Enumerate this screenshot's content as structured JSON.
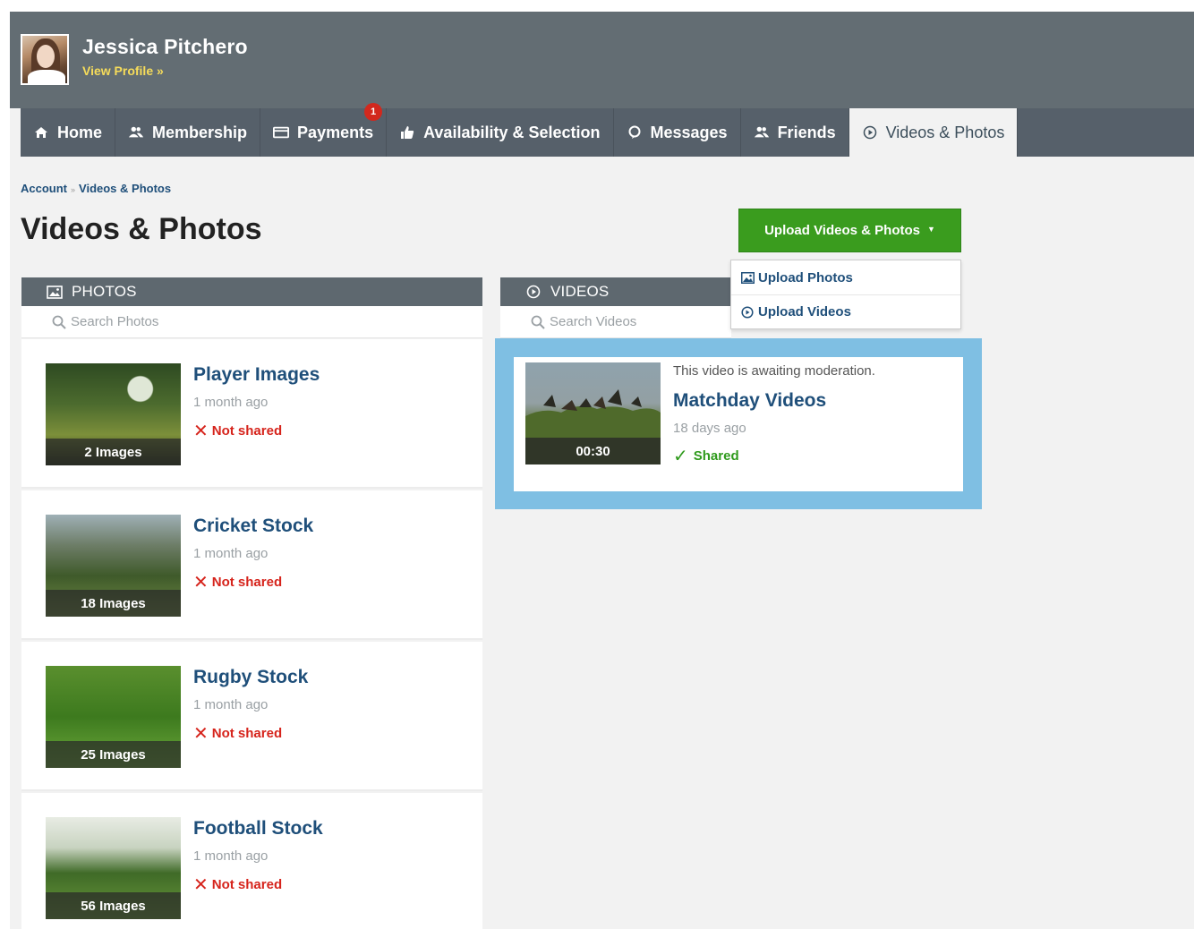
{
  "header": {
    "user_name": "Jessica Pitchero",
    "view_profile": "View Profile »"
  },
  "nav": {
    "items": [
      {
        "label": "Home",
        "icon": "home-icon"
      },
      {
        "label": "Membership",
        "icon": "users-icon"
      },
      {
        "label": "Payments",
        "icon": "credit-card-icon",
        "badge": "1"
      },
      {
        "label": "Availability & Selection",
        "icon": "thumbs-up-icon"
      },
      {
        "label": "Messages",
        "icon": "chat-bubble-icon"
      },
      {
        "label": "Friends",
        "icon": "users-icon"
      },
      {
        "label": "Videos & Photos",
        "icon": "play-circle-icon",
        "active": true
      }
    ]
  },
  "breadcrumb": {
    "items": [
      "Account",
      "Videos & Photos"
    ],
    "separator": "»"
  },
  "page": {
    "title": "Videos & Photos"
  },
  "upload": {
    "button_label": "Upload Videos & Photos",
    "caret": "▼",
    "menu": [
      {
        "label": "Upload Photos",
        "icon": "image-icon"
      },
      {
        "label": "Upload Videos",
        "icon": "play-circle-icon"
      }
    ]
  },
  "photos": {
    "heading": "PHOTOS",
    "search_placeholder": "Search Photos",
    "albums": [
      {
        "title": "Player Images",
        "date": "1 month ago",
        "count": "2 Images",
        "status": "Not shared"
      },
      {
        "title": "Cricket Stock",
        "date": "1 month ago",
        "count": "18 Images",
        "status": "Not shared"
      },
      {
        "title": "Rugby Stock",
        "date": "1 month ago",
        "count": "25 Images",
        "status": "Not shared"
      },
      {
        "title": "Football Stock",
        "date": "1 month ago",
        "count": "56 Images",
        "status": "Not shared"
      }
    ]
  },
  "videos": {
    "heading": "VIDEOS",
    "search_placeholder": "Search Videos",
    "items": [
      {
        "note": "This video is awaiting moderation.",
        "title": "Matchday Videos",
        "date": "18 days ago",
        "duration": "00:30",
        "status": "Shared"
      }
    ]
  },
  "colors": {
    "header_bg": "#636d73",
    "nav_bg": "#56606a",
    "link": "#1f4f7a",
    "accent_green": "#3a9c1e",
    "not_shared_red": "#d6241c",
    "shared_green": "#2f9a1c",
    "highlight_blue": "#7fbfe3"
  }
}
